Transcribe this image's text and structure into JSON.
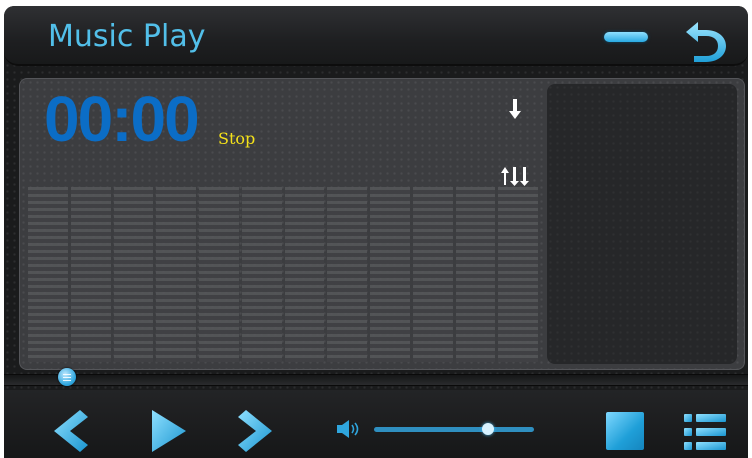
{
  "app": {
    "title": "Music Play"
  },
  "player": {
    "time": "00:00",
    "status": "Stop",
    "progress": 0,
    "volume": 0.7
  },
  "icons": {
    "minimize": "minimize-icon",
    "back": "back-arrow-icon",
    "down_arrow": "down-arrow-icon",
    "equalizer": "equalizer-icon",
    "prev": "previous-icon",
    "play": "play-icon",
    "next": "next-icon",
    "volume": "volume-icon",
    "stop": "stop-icon",
    "list": "playlist-icon"
  },
  "colors": {
    "accent": "#2fa6de",
    "title": "#52bfe9",
    "time": "#0b6dc6",
    "status": "#f5e21a",
    "background": "#1a1b1c"
  }
}
